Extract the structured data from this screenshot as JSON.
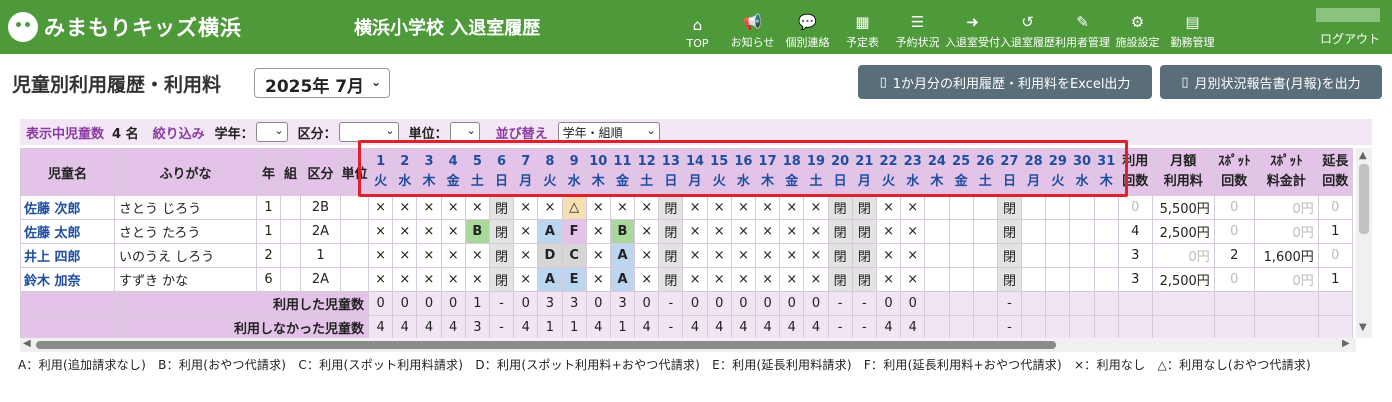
{
  "header": {
    "logo_text": "みまもりキッズ横浜",
    "title": "横浜小学校 入退室履歴",
    "nav": [
      {
        "icon": "home-icon",
        "glyph": "⌂",
        "label": "TOP"
      },
      {
        "icon": "megaphone-icon",
        "glyph": "📢",
        "label": "お知らせ"
      },
      {
        "icon": "chat-icon",
        "glyph": "💬",
        "label": "個別連絡"
      },
      {
        "icon": "calendar-icon",
        "glyph": "▦",
        "label": "予定表"
      },
      {
        "icon": "list-icon",
        "glyph": "☰",
        "label": "予約状況"
      },
      {
        "icon": "sign-in-icon",
        "glyph": "➜",
        "label": "入退室受付"
      },
      {
        "icon": "history-icon",
        "glyph": "↺",
        "label": "入退室履歴"
      },
      {
        "icon": "user-edit-icon",
        "glyph": "✎",
        "label": "利用者管理"
      },
      {
        "icon": "gear-icon",
        "glyph": "⚙",
        "label": "施設設定"
      },
      {
        "icon": "server-icon",
        "glyph": "▤",
        "label": "勤務管理"
      }
    ],
    "logout": "ログアウト"
  },
  "page": {
    "title": "児童別利用履歴・利用料",
    "month": "2025年 7月",
    "excel_button": "1か月分の利用履歴・利用料をExcel出力",
    "report_button": "月別状況報告書(月報)を出力"
  },
  "filter": {
    "count_label": "表示中児童数",
    "count_value": "4 名",
    "narrow_label": "絞り込み",
    "grade_label": "学年：",
    "grade_value": "",
    "kubun_label": "区分：",
    "kubun_value": "",
    "unit_label": "単位：",
    "unit_value": "",
    "sort_label": "並び替え",
    "sort_value": "学年・組順"
  },
  "table": {
    "headers": {
      "name": "児童名",
      "furigana": "ふりがな",
      "grade": "年",
      "class": "組",
      "kubun": "区分",
      "unit": "単位",
      "use_count": [
        "利用",
        "回数"
      ],
      "monthly_fee": [
        "月額",
        "利用料"
      ],
      "spot_count": [
        "ｽﾎﾟｯﾄ",
        "回数"
      ],
      "spot_total": [
        "ｽﾎﾟｯﾄ",
        "料金計"
      ],
      "ext_count": [
        "延長",
        "回数"
      ]
    },
    "days": [
      {
        "d": "1",
        "w": "火"
      },
      {
        "d": "2",
        "w": "水"
      },
      {
        "d": "3",
        "w": "木"
      },
      {
        "d": "4",
        "w": "金"
      },
      {
        "d": "5",
        "w": "土"
      },
      {
        "d": "6",
        "w": "日"
      },
      {
        "d": "7",
        "w": "月"
      },
      {
        "d": "8",
        "w": "火"
      },
      {
        "d": "9",
        "w": "水"
      },
      {
        "d": "10",
        "w": "木"
      },
      {
        "d": "11",
        "w": "金"
      },
      {
        "d": "12",
        "w": "土"
      },
      {
        "d": "13",
        "w": "日"
      },
      {
        "d": "14",
        "w": "月"
      },
      {
        "d": "15",
        "w": "火"
      },
      {
        "d": "16",
        "w": "水"
      },
      {
        "d": "17",
        "w": "木"
      },
      {
        "d": "18",
        "w": "金"
      },
      {
        "d": "19",
        "w": "土"
      },
      {
        "d": "20",
        "w": "日"
      },
      {
        "d": "21",
        "w": "月"
      },
      {
        "d": "22",
        "w": "火"
      },
      {
        "d": "23",
        "w": "水"
      },
      {
        "d": "24",
        "w": "木"
      },
      {
        "d": "25",
        "w": "金"
      },
      {
        "d": "26",
        "w": "土"
      },
      {
        "d": "27",
        "w": "日"
      },
      {
        "d": "28",
        "w": "月"
      },
      {
        "d": "29",
        "w": "火"
      },
      {
        "d": "30",
        "w": "水"
      },
      {
        "d": "31",
        "w": "木"
      }
    ],
    "rows": [
      {
        "name": "佐藤 次郎",
        "furigana": "さとう じろう",
        "grade": "1",
        "class": "",
        "kubun": "2B",
        "unit": "",
        "marks": [
          "×",
          "×",
          "×",
          "×",
          "×",
          "閉",
          "×",
          "×",
          "△",
          "×",
          "×",
          "×",
          "閉",
          "×",
          "×",
          "×",
          "×",
          "×",
          "×",
          "閉",
          "閉",
          "×",
          "×",
          "",
          "",
          "",
          "閉",
          "",
          "",
          "",
          ""
        ],
        "use_count": "0",
        "monthly_fee": "5,500円",
        "spot_count": "0",
        "spot_total": "0円",
        "ext_count": "0"
      },
      {
        "name": "佐藤 太郎",
        "furigana": "さとう たろう",
        "grade": "1",
        "class": "",
        "kubun": "2A",
        "unit": "",
        "marks": [
          "×",
          "×",
          "×",
          "×",
          "B",
          "閉",
          "×",
          "A",
          "F",
          "×",
          "B",
          "×",
          "閉",
          "×",
          "×",
          "×",
          "×",
          "×",
          "×",
          "閉",
          "閉",
          "×",
          "×",
          "",
          "",
          "",
          "閉",
          "",
          "",
          "",
          ""
        ],
        "use_count": "4",
        "monthly_fee": "2,500円",
        "spot_count": "0",
        "spot_total": "0円",
        "ext_count": "1"
      },
      {
        "name": "井上 四郎",
        "furigana": "いのうえ しろう",
        "grade": "2",
        "class": "",
        "kubun": "1",
        "unit": "",
        "marks": [
          "×",
          "×",
          "×",
          "×",
          "×",
          "閉",
          "×",
          "D",
          "C",
          "×",
          "A",
          "×",
          "閉",
          "×",
          "×",
          "×",
          "×",
          "×",
          "×",
          "閉",
          "閉",
          "×",
          "×",
          "",
          "",
          "",
          "閉",
          "",
          "",
          "",
          ""
        ],
        "use_count": "3",
        "monthly_fee": "0円",
        "spot_count": "2",
        "spot_total": "1,600円",
        "ext_count": "0"
      },
      {
        "name": "鈴木 加奈",
        "furigana": "すずき かな",
        "grade": "6",
        "class": "",
        "kubun": "2A",
        "unit": "",
        "marks": [
          "×",
          "×",
          "×",
          "×",
          "×",
          "閉",
          "×",
          "A",
          "E",
          "×",
          "A",
          "×",
          "閉",
          "×",
          "×",
          "×",
          "×",
          "×",
          "×",
          "閉",
          "閉",
          "×",
          "×",
          "",
          "",
          "",
          "閉",
          "",
          "",
          "",
          ""
        ],
        "use_count": "3",
        "monthly_fee": "2,500円",
        "spot_count": "0",
        "spot_total": "0円",
        "ext_count": "1"
      }
    ],
    "summary": [
      {
        "label": "利用した児童数",
        "values": [
          "0",
          "0",
          "0",
          "0",
          "1",
          "-",
          "0",
          "3",
          "3",
          "0",
          "3",
          "0",
          "-",
          "0",
          "0",
          "0",
          "0",
          "0",
          "0",
          "-",
          "-",
          "0",
          "0",
          "",
          "",
          "",
          "-",
          "",
          "",
          "",
          ""
        ]
      },
      {
        "label": "利用しなかった児童数",
        "values": [
          "4",
          "4",
          "4",
          "4",
          "3",
          "-",
          "4",
          "1",
          "1",
          "4",
          "1",
          "4",
          "-",
          "4",
          "4",
          "4",
          "4",
          "4",
          "4",
          "-",
          "-",
          "4",
          "4",
          "",
          "",
          "",
          "-",
          "",
          "",
          "",
          ""
        ]
      }
    ]
  },
  "legend": "A：利用(追加請求なし)　B：利用(おやつ代請求)　C：利用(スポット利用料請求)　D：利用(スポット利用料+おやつ代請求)　E：利用(延長利用料請求)　F：利用(延長利用料+おやつ代請求)　×：利用なし　△：利用なし(おやつ代請求)"
}
